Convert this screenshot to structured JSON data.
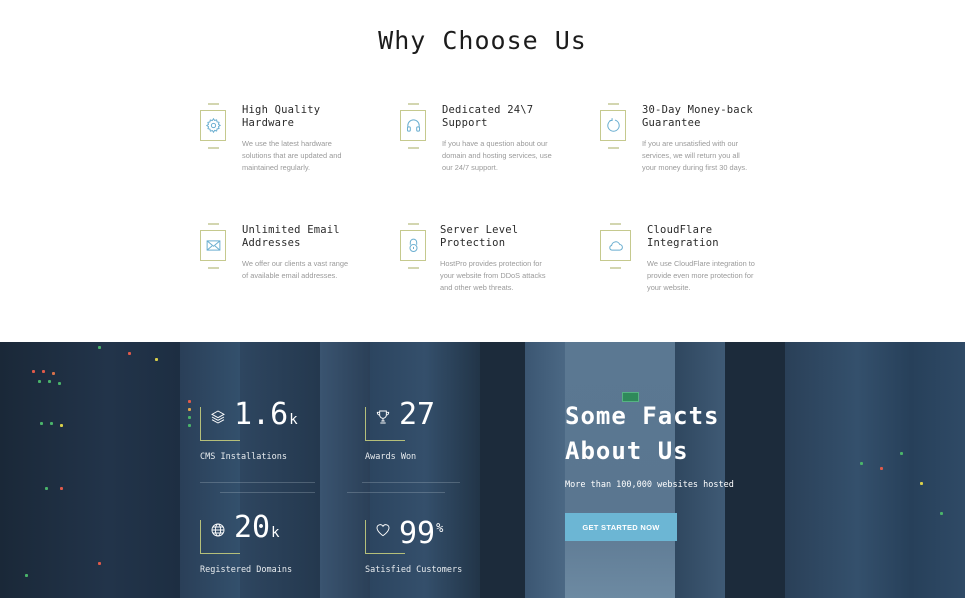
{
  "why_choose_us": {
    "title": "Why Choose Us",
    "features": [
      {
        "icon": "gear-icon",
        "title_line1": "High Quality",
        "title_line2": "Hardware",
        "description": "We use the latest hardware solutions that are updated and maintained regularly."
      },
      {
        "icon": "headphones-icon",
        "title_line1": "Dedicated 24\\7",
        "title_line2": "Support",
        "description": "If you have a question about our domain and hosting services, use our 24/7 support."
      },
      {
        "icon": "refresh-icon",
        "title_line1": "30-Day Money-back",
        "title_line2": "Guarantee",
        "description": "If you are unsatisfied with our services, we will return you all your money during first 30 days."
      },
      {
        "icon": "envelope-icon",
        "title_line1": "Unlimited Email",
        "title_line2": "Addresses",
        "description": "We offer our clients a vast range of available email addresses."
      },
      {
        "icon": "lock-icon",
        "title_line1": "Server Level",
        "title_line2": "Protection",
        "description": "HostPro provides protection for your website from DDoS attacks and other web threats."
      },
      {
        "icon": "cloud-icon",
        "title_line1": "CloudFlare",
        "title_line2": "Integration",
        "description": "We use CloudFlare integration to provide even more protection for your website."
      }
    ]
  },
  "facts": {
    "title_line1": "Some Facts",
    "title_line2": "About Us",
    "subtitle": "More than 100,000 websites hosted",
    "cta_label": "GET STARTED NOW",
    "stats": [
      {
        "icon": "layers-icon",
        "value": "1.6",
        "suffix": "k",
        "label": "CMS Installations"
      },
      {
        "icon": "trophy-icon",
        "value": "27",
        "suffix": "",
        "label": "Awards Won"
      },
      {
        "icon": "globe-icon",
        "value": "20",
        "suffix": "k",
        "label": "Registered Domains"
      },
      {
        "icon": "heart-icon",
        "value": "99",
        "suffix": "%",
        "label": "Satisfied Customers"
      }
    ]
  },
  "colors": {
    "accent_blue": "#6cb6d4",
    "accent_olive": "#c5c98e",
    "dark_bg": "#1b2a3b",
    "icon_blue": "#6aaed0"
  }
}
